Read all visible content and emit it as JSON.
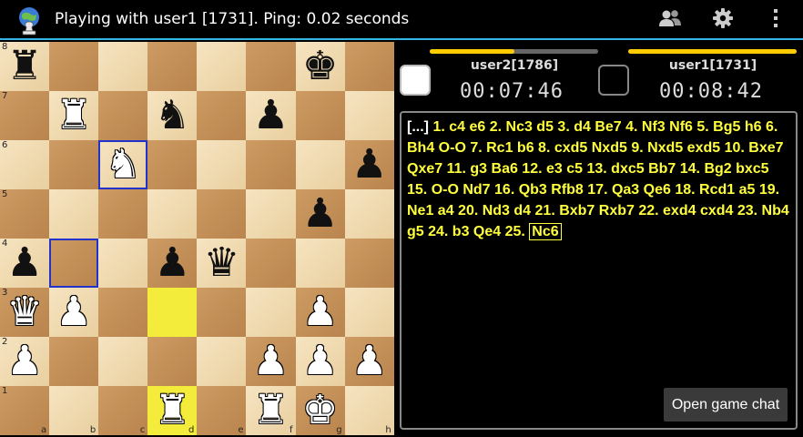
{
  "header": {
    "title": "Playing with user1 [1731]. Ping: 0.02 seconds",
    "app_icon": "chess-pawn-globe-icon",
    "actions": [
      "people-icon",
      "gear-icon",
      "overflow-menu-icon"
    ]
  },
  "board": {
    "orientation": "white-bottom",
    "files": [
      "a",
      "b",
      "c",
      "d",
      "e",
      "f",
      "g",
      "h"
    ],
    "ranks": [
      "8",
      "7",
      "6",
      "5",
      "4",
      "3",
      "2",
      "1"
    ],
    "highlight_squares": [
      "d3",
      "d1"
    ],
    "selected_squares": [
      "c6",
      "b4"
    ],
    "pieces": {
      "a8": "bR",
      "g8": "bK",
      "b7": "wR",
      "d7": "bN",
      "f7": "bP",
      "c6": "wN",
      "h6": "bP",
      "g5": "bP",
      "a4": "bP",
      "d4": "bP",
      "e4": "bQ",
      "a3": "wQ",
      "b3": "wP",
      "g3": "wP",
      "a2": "wP",
      "f2": "wP",
      "g2": "wP",
      "h2": "wP",
      "d1": "wR",
      "f1": "wR",
      "g1": "wK"
    }
  },
  "players": {
    "left": {
      "name": "user2[1786]",
      "time": "00:07:46",
      "color": "white",
      "bar_color": "#ffcc00",
      "bar_fraction": 0.5
    },
    "right": {
      "name": "user1[1731]",
      "time": "00:08:42",
      "color": "black",
      "bar_color": "#ffcc00",
      "bar_fraction": 1.0
    }
  },
  "moves": {
    "prefix": "[...]",
    "text": " 1. c4 e6 2. Nc3 d5 3. d4 Be7 4. Nf3 Nf6 5. Bg5 h6 6. Bh4 O-O 7. Rc1 b6 8. cxd5 Nxd5 9. Nxd5 exd5 10. Bxe7 Qxe7 11. g3 Ba6 12. e3 c5 13. dxc5 Bb7 14. Bg2 bxc5 15. O-O Nd7 16. Qb3 Rfb8 17. Qa3 Qe6 18. Rcd1 a5 19. Ne1 a4 20. Nd3 d4 21. Bxb7 Rxb7 22. exd4 cxd4 23. Nb4 g5 24. b3 Qe4 25. ",
    "current": "Nc6"
  },
  "chat_button_label": "Open game chat"
}
